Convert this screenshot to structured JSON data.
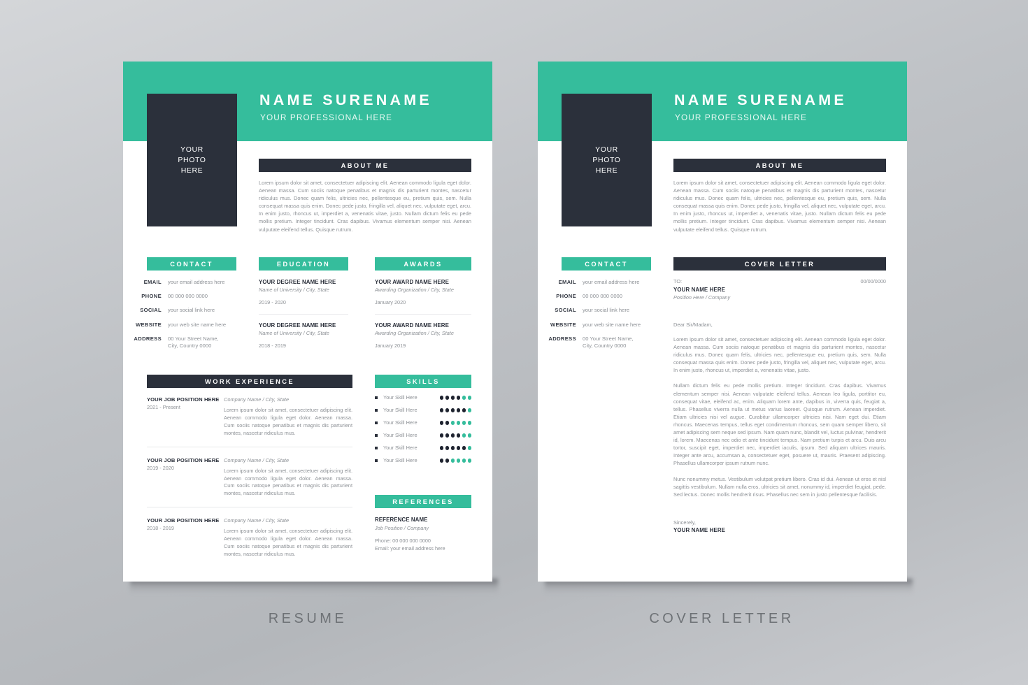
{
  "theme": {
    "accent_teal": "#35bd9c",
    "dark_navy": "#2b303b",
    "body_text": "#8d9196",
    "page_background": "#ffffff",
    "canvas_background": "#bfc2c6"
  },
  "captions": {
    "resume": "RESUME",
    "cover_letter": "COVER LETTER"
  },
  "header": {
    "name": "NAME SURENAME",
    "subtitle": "YOUR PROFESSIONAL HERE"
  },
  "photo_placeholder": {
    "line1": "YOUR",
    "line2": "PHOTO",
    "line3": "HERE"
  },
  "sections": {
    "about_me": "ABOUT ME",
    "contact": "CONTACT",
    "education": "EDUCATION",
    "awards": "AWARDS",
    "work_experience": "WORK EXPERIENCE",
    "skills": "SKILLS",
    "references": "REFERENCES",
    "cover_letter": "COVER LETTER"
  },
  "about_me_text": "Lorem ipsum dolor sit amet, consectetuer adipiscing elit. Aenean commodo ligula eget dolor. Aenean massa. Cum sociis natoque penatibus et magnis dis parturient montes, nascetur ridiculus mus. Donec quam felis, ultricies nec, pellentesque eu, pretium quis, sem. Nulla consequat massa quis enim. Donec pede justo, fringilla vel, aliquet nec, vulputate eget, arcu. In enim justo, rhoncus ut, imperdiet a, venenatis vitae, justo. Nullam dictum felis eu pede mollis pretium. Integer tincidunt. Cras dapibus. Vivamus elementum semper nisi. Aenean vulputate eleifend tellus. Quisque rutrum.",
  "contact": [
    {
      "key": "EMAIL",
      "value": "your email address here"
    },
    {
      "key": "PHONE",
      "value": "00 000 000 0000"
    },
    {
      "key": "SOCIAL",
      "value": "your social link here"
    },
    {
      "key": "WEBSITE",
      "value": "your web site name here"
    },
    {
      "key": "ADDRESS",
      "value": "00 Your Street Name,\nCity, Country 0000"
    }
  ],
  "education": [
    {
      "title": "YOUR DEGREE NAME HERE",
      "sub": "Name of University / City, State",
      "date": "2019 - 2020"
    },
    {
      "title": "YOUR DEGREE NAME HERE",
      "sub": "Name of University / City, State",
      "date": "2018 - 2019"
    }
  ],
  "awards": [
    {
      "title": "YOUR AWARD NAME HERE",
      "sub": "Awarding Organization / City, State",
      "date": "January 2020"
    },
    {
      "title": "YOUR AWARD NAME HERE",
      "sub": "Awarding Organization / City, State",
      "date": "January 2019"
    }
  ],
  "work_experience": [
    {
      "position": "YOUR JOB POSITION HERE",
      "date": "2021 - Present",
      "company": "Company Name / City, State",
      "description": "Lorem ipsum dolor sit amet, consectetuer adipiscing elit. Aenean commodo ligula eget dolor. Aenean massa. Cum sociis natoque penatibus et magnis dis parturient montes, nascetur ridiculus mus."
    },
    {
      "position": "YOUR JOB POSITION HERE",
      "date": "2019 - 2020",
      "company": "Company Name / City, State",
      "description": "Lorem ipsum dolor sit amet, consectetuer adipiscing elit. Aenean commodo ligula eget dolor. Aenean massa. Cum sociis natoque penatibus et magnis dis parturient montes, nascetur ridiculus mus."
    },
    {
      "position": "YOUR JOB POSITION HERE",
      "date": "2018 - 2019",
      "company": "Company Name / City, State",
      "description": "Lorem ipsum dolor sit amet, consectetuer adipiscing elit. Aenean commodo ligula eget dolor. Aenean massa. Cum sociis natoque penatibus et magnis dis parturient montes, nascetur ridiculus mus."
    }
  ],
  "skills": [
    {
      "label": "Your Skill Here",
      "filled": 4,
      "total": 6
    },
    {
      "label": "Your Skill Here",
      "filled": 5,
      "total": 6
    },
    {
      "label": "Your Skill Here",
      "filled": 2,
      "total": 6
    },
    {
      "label": "Your Skill Here",
      "filled": 4,
      "total": 6
    },
    {
      "label": "Your Skill Here",
      "filled": 5,
      "total": 6
    },
    {
      "label": "Your Skill Here",
      "filled": 2,
      "total": 6
    }
  ],
  "references": {
    "name": "REFERENCE NAME",
    "position": "Job Position / Company",
    "phone": "Phone: 00 000 000 0000",
    "email": "Email: your email address here"
  },
  "cover_letter": {
    "to_label": "TO:",
    "to_name": "YOUR NAME HERE",
    "to_position": "Position Here / Company",
    "date": "00/00/0000",
    "greeting": "Dear Sir/Madam,",
    "paragraphs": [
      "Lorem ipsum dolor sit amet, consectetuer adipiscing elit. Aenean commodo ligula eget dolor. Aenean massa. Cum sociis natoque penatibus et magnis dis parturient montes, nascetur ridiculus mus. Donec quam felis, ultricies nec, pellentesque eu, pretium quis, sem. Nulla consequat massa quis enim. Donec pede justo, fringilla vel, aliquet nec, vulputate eget, arcu. In enim justo, rhoncus ut, imperdiet a, venenatis vitae, justo.",
      "Nullam dictum felis eu pede mollis pretium. Integer tincidunt. Cras dapibus. Vivamus elementum semper nisi. Aenean vulputate eleifend tellus. Aenean leo ligula, porttitor eu, consequat vitae, eleifend ac, enim. Aliquam lorem ante, dapibus in, viverra quis, feugiat a, tellus. Phasellus viverra nulla ut metus varius laoreet. Quisque rutrum. Aenean imperdiet. Etiam ultricies nisi vel augue. Curabitur ullamcorper ultricies nisi. Nam eget dui. Etiam rhoncus. Maecenas tempus, tellus eget condimentum rhoncus, sem quam semper libero, sit amet adipiscing sem neque sed ipsum. Nam quam nunc, blandit vel, luctus pulvinar, hendrerit id, lorem. Maecenas nec odio et ante tincidunt tempus. Nam pretium turpis et arcu. Duis arcu tortor, suscipit eget, imperdiet nec, imperdiet iaculis, ipsum. Sed aliquam ultrices mauris. Integer ante arcu, accumsan a, consectetuer eget, posuere ut, mauris. Praesent adipiscing. Phasellus ullamcorper ipsum rutrum nunc.",
      "Nunc nonummy metus. Vestibulum volutpat pretium libero. Cras id dui. Aenean ut eros et nisl sagittis vestibulum. Nullam nulla eros, ultricies sit amet, nonummy id, imperdiet feugiat, pede. Sed lectus. Donec mollis hendrerit risus. Phasellus nec sem in justo pellentesque facilisis."
    ],
    "sign_off": "Sincerely,",
    "sign_name": "YOUR NAME HERE"
  }
}
